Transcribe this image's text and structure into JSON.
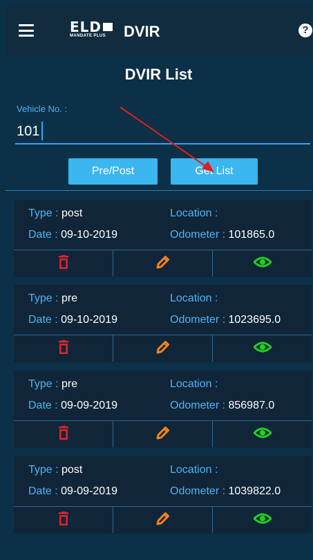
{
  "header": {
    "logo_text": "ELD",
    "logo_subtext": "MANDATE PLUS",
    "title": "DVIR"
  },
  "page": {
    "title": "DVIR List",
    "vehicle_label": "Vehicle No. :",
    "vehicle_value": "101"
  },
  "buttons": {
    "pre_post": "Pre/Post",
    "get_list": "Get List"
  },
  "labels": {
    "type": "Type : ",
    "date": "Date : ",
    "location": "Location :",
    "odometer": "Odometer : "
  },
  "records": [
    {
      "type": "post",
      "date": "09-10-2019",
      "location": "",
      "odometer": "101865.0"
    },
    {
      "type": "pre",
      "date": "09-10-2019",
      "location": "",
      "odometer": "1023695.0"
    },
    {
      "type": "pre",
      "date": "09-09-2019",
      "location": "",
      "odometer": "856987.0"
    },
    {
      "type": "post",
      "date": "09-09-2019",
      "location": "",
      "odometer": "1039822.0"
    }
  ],
  "icons": {
    "menu": "menu-icon",
    "help": "help-icon",
    "delete": "trash-icon",
    "edit": "pencil-icon",
    "view": "eye-icon"
  },
  "colors": {
    "background": "#0c3047",
    "header": "#102c3e",
    "accent": "#3cb6ef",
    "label": "#4fb3f5",
    "delete": "#e3222b",
    "edit": "#f5821f",
    "view": "#1fd11f"
  }
}
